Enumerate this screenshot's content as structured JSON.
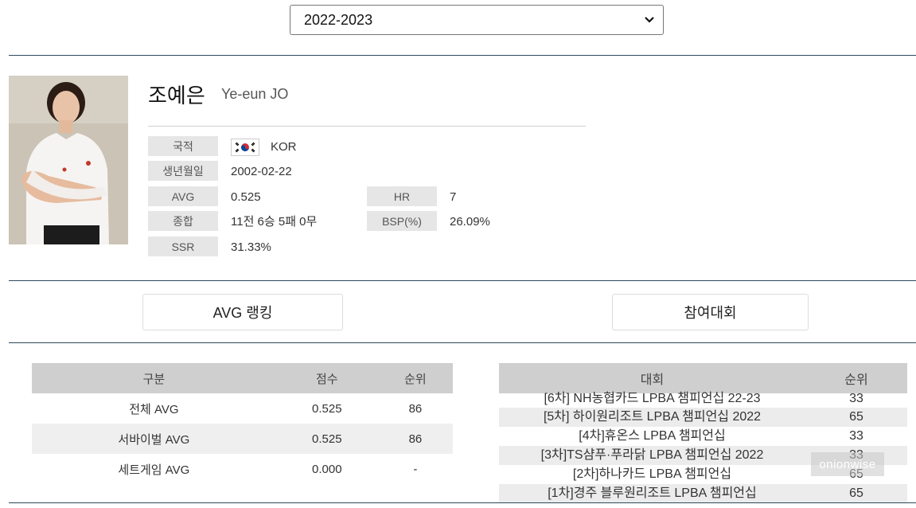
{
  "season": {
    "selected": "2022-2023"
  },
  "player": {
    "name_ko": "조예은",
    "name_en": "Ye-eun JO",
    "info": {
      "nationality_label": "국적",
      "nationality": "KOR",
      "birth_label": "생년월일",
      "birth": "2002-02-22",
      "avg_label": "AVG",
      "avg": "0.525",
      "hr_label": "HR",
      "hr": "7",
      "record_label": "종합",
      "record": "11전 6승 5패 0무",
      "bsp_label": "BSP(%)",
      "bsp": "26.09%",
      "ssr_label": "SSR",
      "ssr": "31.33%"
    }
  },
  "tabs": {
    "avg_ranking": "AVG 랭킹",
    "tournaments": "참여대회"
  },
  "avg_table": {
    "headers": [
      "구분",
      "점수",
      "순위"
    ],
    "rows": [
      [
        "전체 AVG",
        "0.525",
        "86"
      ],
      [
        "서바이벌 AVG",
        "0.525",
        "86"
      ],
      [
        "세트게임 AVG",
        "0.000",
        "-"
      ]
    ]
  },
  "tour_table": {
    "headers": [
      "대회",
      "순위"
    ],
    "rows": [
      [
        "[6차] NH농협카드 LPBA 챔피언십 22-23",
        "33"
      ],
      [
        "[5차] 하이원리조트 LPBA 챔피언십 2022",
        "65"
      ],
      [
        "[4차]휴온스 LPBA 챔피언십",
        "33"
      ],
      [
        "[3차]TS샴푸·푸라닭 LPBA 챔피언십 2022",
        "33"
      ],
      [
        "[2차]하나카드 LPBA 챔피언십",
        "65"
      ],
      [
        "[1차]경주 블루원리조트 LPBA 챔피언십",
        "65"
      ]
    ]
  },
  "watermark": "onionwise",
  "colors": {
    "rule": "#2d4a5a",
    "header_bg": "#cfcfcf",
    "label_bg": "#e6e6e6"
  }
}
